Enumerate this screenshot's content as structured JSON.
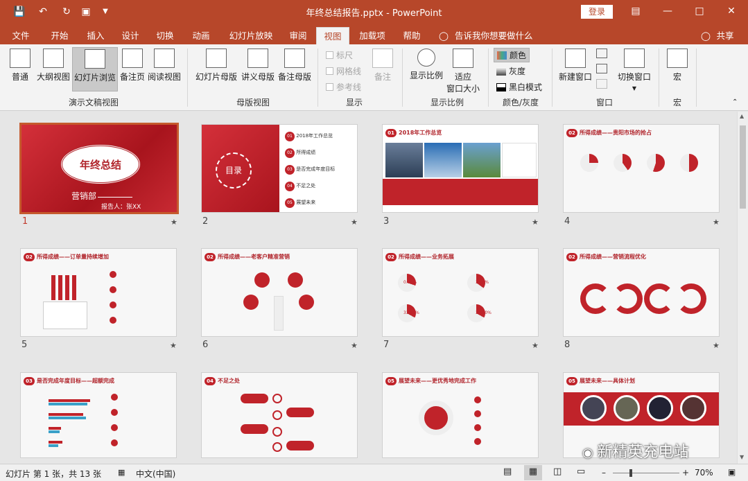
{
  "window": {
    "title": "年终总结报告.pptx - PowerPoint",
    "login_label": "登录",
    "qat_icons": [
      "save-icon",
      "undo-icon",
      "redo-icon",
      "present-icon",
      "customize-icon"
    ]
  },
  "menu": {
    "tabs": [
      "文件",
      "开始",
      "插入",
      "设计",
      "切换",
      "动画",
      "幻灯片放映",
      "审阅",
      "视图",
      "加载项",
      "帮助"
    ],
    "active_tab": "视图",
    "tell_me": "告诉我你想要做什么",
    "share": "共享"
  },
  "ribbon": {
    "groups": {
      "presentation_views": "演示文稿视图",
      "master_views": "母版视图",
      "show": "显示",
      "zoom": "显示比例",
      "color": "颜色/灰度",
      "window": "窗口",
      "macros": "宏"
    },
    "buttons": {
      "normal": "普通",
      "outline": "大纲视图",
      "sorter": "幻灯片浏览",
      "notes_page": "备注页",
      "reading": "阅读视图",
      "slide_master": "幻灯片母版",
      "handout_master": "讲义母版",
      "notes_master": "备注母版",
      "ruler": "标尺",
      "gridlines": "网格线",
      "guides": "参考线",
      "notes": "备注",
      "zoom": "显示比例",
      "fit_window_1": "适应",
      "fit_window_2": "窗口大小",
      "color": "颜色",
      "grayscale": "灰度",
      "bw": "黑白模式",
      "new_window": "新建窗口",
      "switch_window": "切换窗口",
      "macros": "宏"
    }
  },
  "slides": [
    {
      "num": "1",
      "title": "年终总结",
      "sub": "营销部",
      "reporter": "报告人：张XX"
    },
    {
      "num": "2",
      "title": "目录",
      "items": [
        {
          "n": "01",
          "t": "2018年工作总览"
        },
        {
          "n": "02",
          "t": "所得成绩"
        },
        {
          "n": "03",
          "t": "是否完成年度目标"
        },
        {
          "n": "04",
          "t": "不足之处"
        },
        {
          "n": "05",
          "t": "展望未来"
        }
      ]
    },
    {
      "num": "3",
      "header_num": "01",
      "header": "2018年工作总览"
    },
    {
      "num": "4",
      "header_num": "02",
      "header": "所得成绩——贵阳市场的抢占"
    },
    {
      "num": "5",
      "header_num": "02",
      "header": "所得成绩——订单量持续增加"
    },
    {
      "num": "6",
      "header_num": "02",
      "header": "所得成绩——老客户精准营销"
    },
    {
      "num": "7",
      "header_num": "02",
      "header": "所得成绩——业务拓展",
      "pcts": [
        "0.08%",
        "35.5%",
        "33.28%",
        "33.10%"
      ]
    },
    {
      "num": "8",
      "header_num": "02",
      "header": "所得成绩——营销流程优化"
    },
    {
      "num": "9",
      "header_num": "03",
      "header": "是否完成年度目标——超额完成"
    },
    {
      "num": "10",
      "header_num": "04",
      "header": "不足之处"
    },
    {
      "num": "11",
      "header_num": "05",
      "header": "展望未来——更优秀地完成工作"
    },
    {
      "num": "12",
      "header_num": "05",
      "header": "展望未来——具体计划"
    }
  ],
  "status": {
    "slide_info": "幻灯片 第 1 张，共 13 张",
    "language": "中文(中国)",
    "zoom": "70%"
  },
  "watermark": "新精英充电站",
  "colors": {
    "accent": "#b7472a",
    "slide_red": "#c0232a"
  }
}
